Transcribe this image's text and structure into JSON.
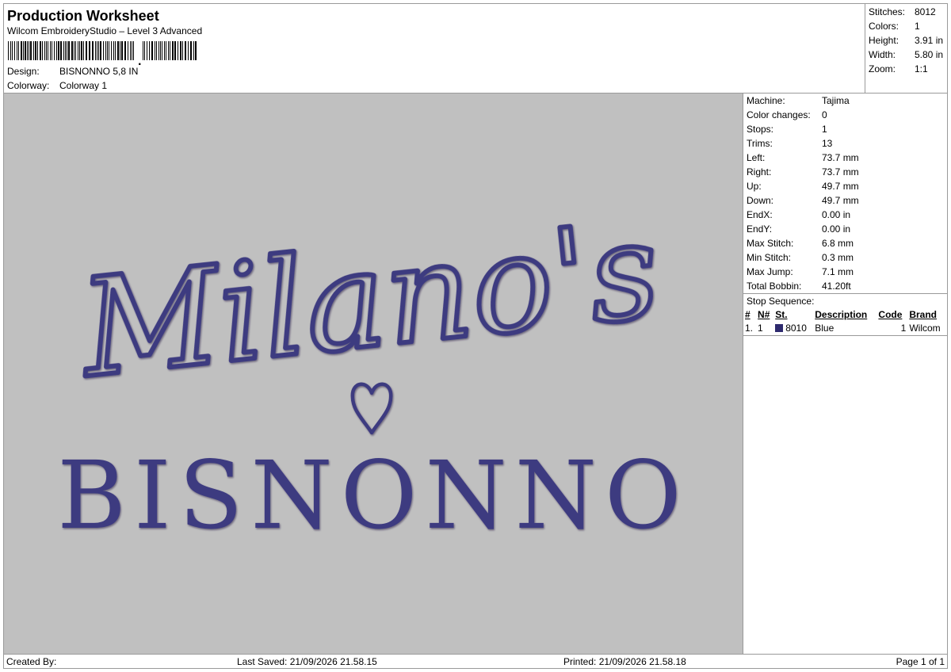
{
  "header": {
    "title": "Production Worksheet",
    "software": "Wilcom EmbroideryStudio – Level 3 Advanced",
    "design_label": "Design:",
    "design_value": "BISNONNO 5,8 IN",
    "colorway_label": "Colorway:",
    "colorway_value": "Colorway 1"
  },
  "stats": [
    {
      "label": "Stitches:",
      "value": "8012"
    },
    {
      "label": "Colors:",
      "value": "1"
    },
    {
      "label": "Height:",
      "value": "3.91 in"
    },
    {
      "label": "Width:",
      "value": "5.80 in"
    },
    {
      "label": "Zoom:",
      "value": "1:1"
    }
  ],
  "machine_info": [
    {
      "label": "Machine:",
      "value": "Tajima"
    },
    {
      "label": "Color changes:",
      "value": "0"
    },
    {
      "label": "Stops:",
      "value": "1"
    },
    {
      "label": "Trims:",
      "value": "13"
    },
    {
      "label": "Left:",
      "value": "73.7 mm"
    },
    {
      "label": "Right:",
      "value": "73.7 mm"
    },
    {
      "label": "Up:",
      "value": "49.7 mm"
    },
    {
      "label": "Down:",
      "value": "49.7 mm"
    },
    {
      "label": "EndX:",
      "value": "0.00 in"
    },
    {
      "label": "EndY:",
      "value": "0.00 in"
    },
    {
      "label": "Max Stitch:",
      "value": "6.8 mm"
    },
    {
      "label": "Min Stitch:",
      "value": "0.3 mm"
    },
    {
      "label": "Max Jump:",
      "value": "7.1 mm"
    },
    {
      "label": "Total Bobbin:",
      "value": "41.20ft"
    }
  ],
  "stop_sequence": {
    "heading": "Stop Sequence:",
    "columns": [
      "#",
      "N#",
      "St.",
      "Description",
      "Code",
      "Brand"
    ],
    "rows": [
      {
        "index": "1.",
        "n": "1",
        "color": "#2e2a6e",
        "st": "8010",
        "description": "Blue",
        "code": "1",
        "brand": "Wilcom"
      }
    ]
  },
  "design": {
    "script_text": "Milano's",
    "heart_icon": "heart-outline-icon",
    "block_text": "BISNONNO",
    "thread_color": "#3d3a80",
    "background_color": "#c0c0c0"
  },
  "footer": {
    "created_by": "Created By:",
    "last_saved": "Last Saved: 21/09/2026 21.58.15",
    "printed": "Printed: 21/09/2026 21.58.18",
    "page": "Page 1 of 1"
  }
}
